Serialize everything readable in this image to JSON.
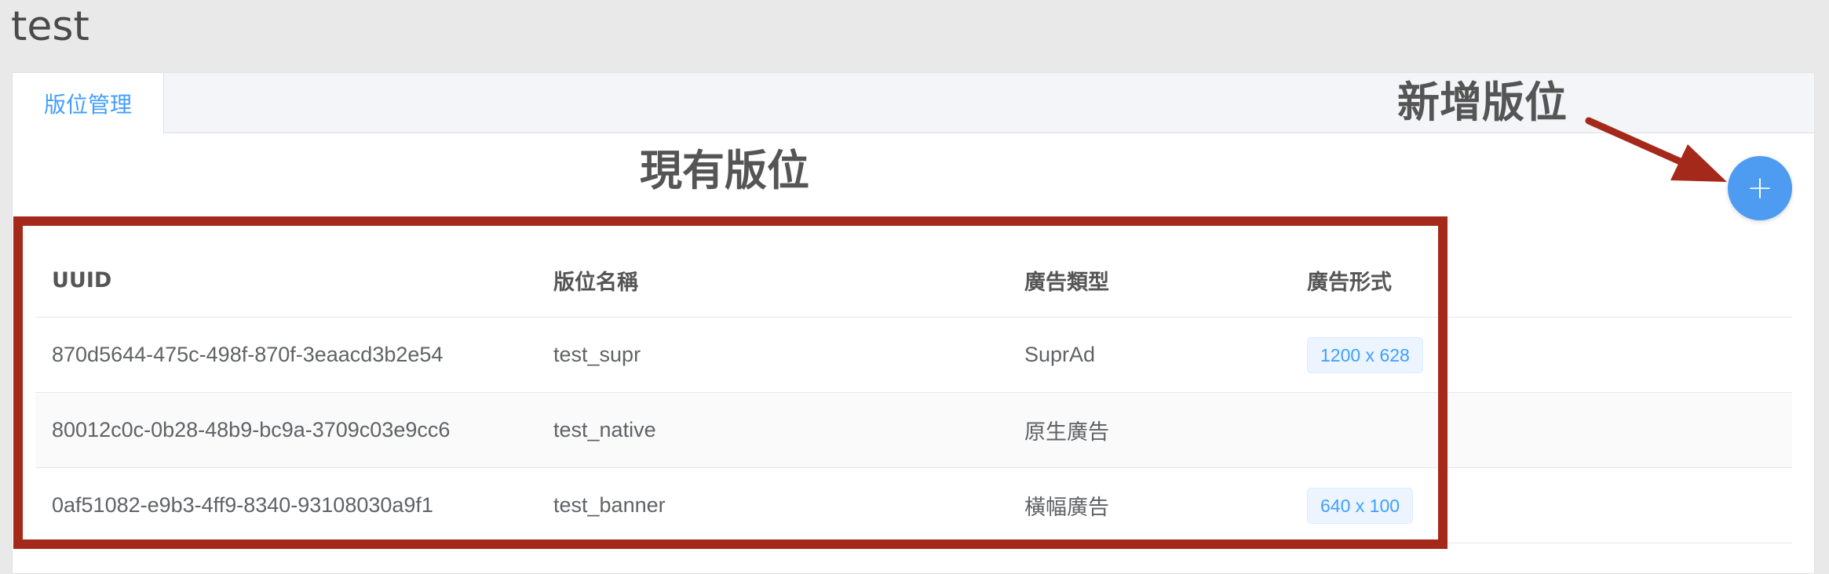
{
  "page": {
    "title": "test"
  },
  "tabs": [
    {
      "label": "版位管理",
      "active": true
    }
  ],
  "annotations": {
    "existing": "現有版位",
    "add": "新增版位"
  },
  "add_button": {
    "icon": "plus-icon",
    "symbol": "+"
  },
  "colors": {
    "accent": "#409eff",
    "highlight": "#a4291a",
    "add_button": "#4d9cf2"
  },
  "table": {
    "headers": [
      "UUID",
      "版位名稱",
      "廣告類型",
      "廣告形式"
    ],
    "rows": [
      {
        "uuid": "870d5644-475c-498f-870f-3eaacd3b2e54",
        "name": "test_supr",
        "type": "SuprAd",
        "format": "1200 x 628"
      },
      {
        "uuid": "80012c0c-0b28-48b9-bc9a-3709c03e9cc6",
        "name": "test_native",
        "type": "原生廣告",
        "format": ""
      },
      {
        "uuid": "0af51082-e9b3-4ff9-8340-93108030a9f1",
        "name": "test_banner",
        "type": "橫幅廣告",
        "format": "640 x 100"
      }
    ]
  }
}
